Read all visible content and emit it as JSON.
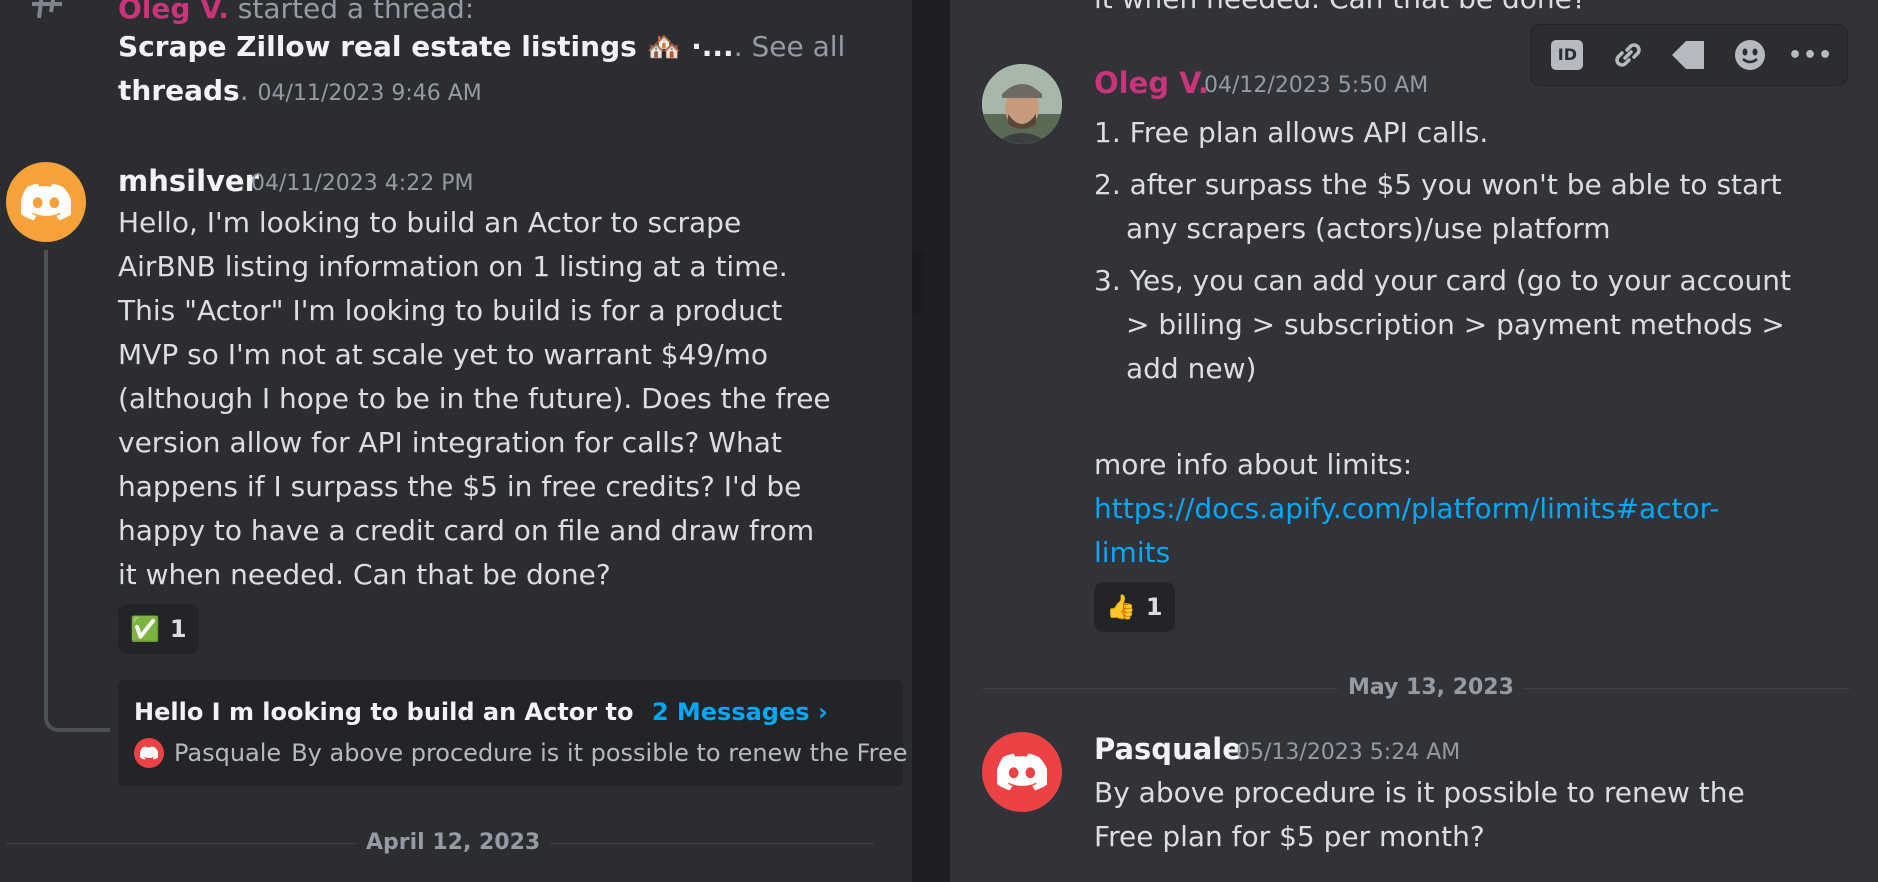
{
  "left": {
    "thread_notice": {
      "author": "Oleg V.",
      "action": "started a thread:",
      "thread_title": "Scrape Zillow real estate listings 🏘️ ·...",
      "see_all_a": ". See all",
      "see_all_b": "threads",
      "timestamp": "04/11/2023 9:46 AM"
    },
    "message": {
      "author": "mhsilver",
      "timestamp": "04/11/2023 4:22 PM",
      "lines": [
        "Hello, I'm looking to build an Actor to scrape",
        "AirBNB listing information on 1 listing at a time.",
        "This \"Actor\" I'm looking to build is for a product",
        "MVP so I'm not at scale yet to warrant $49/mo",
        "(although I hope to be in the future). Does the free",
        "version allow for API integration for calls? What",
        "happens if I surpass the $5 in free credits? I'd be",
        "happy to have a credit card on file and draw from",
        "it when needed. Can that be done?"
      ],
      "reaction": {
        "emoji": "✅",
        "count": "1"
      }
    },
    "thread_card": {
      "title": "Hello I m looking to build an Actor to",
      "messages": "2 Messages ›",
      "last_author": "Pasquale",
      "last_text": "By above procedure is it possible to renew the Free"
    },
    "date_separator": "April 12, 2023"
  },
  "right": {
    "top_cutoff": "it when needed. Can that be done?",
    "toolbar": {
      "icons": [
        "id-icon",
        "link-icon",
        "tag-icon",
        "emoji-icon",
        "more-icon"
      ],
      "id_label": "ID",
      "more_label": "•••"
    },
    "reply": {
      "author": "Oleg V.",
      "timestamp": "04/12/2023 5:50 AM",
      "items": [
        {
          "num": "1.",
          "lines": [
            "Free plan allows API calls."
          ]
        },
        {
          "num": "2.",
          "lines": [
            "after surpass the $5 you won't be able to start",
            "any scrapers (actors)/use platform"
          ]
        },
        {
          "num": "3.",
          "lines": [
            "Yes, you can add your card (go to your account",
            "> billing > subscription > payment methods >",
            "add new)"
          ]
        }
      ],
      "more_info": "more info about limits:",
      "link_line1": "https://docs.apify.com/platform/limits#actor-",
      "link_line2": "limits",
      "reaction": {
        "emoji": "👍",
        "count": "1"
      }
    },
    "date_separator": "May 13, 2023",
    "pasquale": {
      "author": "Pasquale",
      "timestamp": "05/13/2023 5:24 AM",
      "lines": [
        "By above procedure is it possible to renew the",
        "Free plan for $5 per month?"
      ]
    }
  },
  "colors": {
    "background": "#2b2d31",
    "background_right": "#313338",
    "oleg_name": "#c9347a",
    "link": "#00a8fc",
    "discord_orange": "#f6a23a",
    "discord_red": "#ed4245"
  }
}
